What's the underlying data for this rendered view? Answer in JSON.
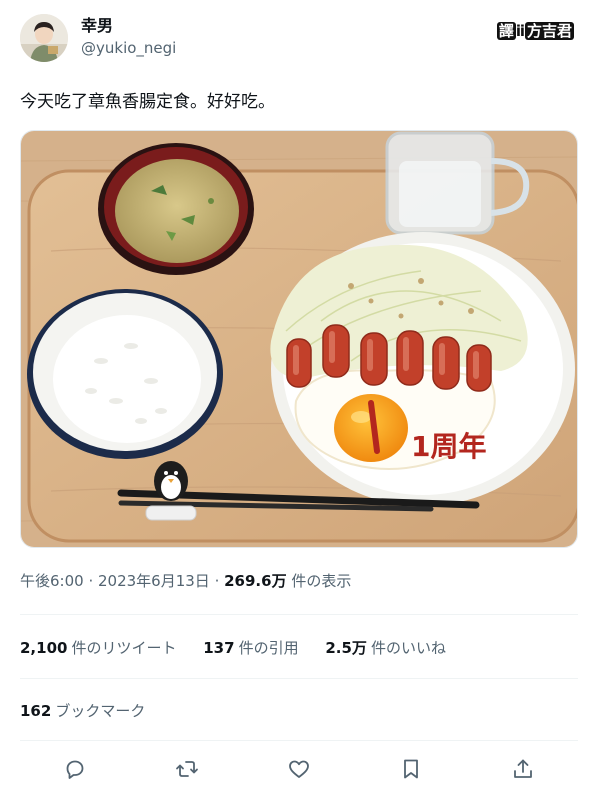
{
  "author": {
    "display_name": "幸男",
    "handle": "@yukio_negi"
  },
  "watermark": {
    "badge": "譯",
    "middle": "ⅱ",
    "name": "方吉君"
  },
  "tweet": {
    "text": "今天吃了章魚香腸定食。好好吃。",
    "photo_alt": "",
    "plate_writing": "1周年"
  },
  "meta": {
    "time": "午後6:00",
    "sep1": " · ",
    "date": "2023年6月13日",
    "sep2": " · ",
    "views_count": "269.6万",
    "views_label": " 件の表示"
  },
  "stats": {
    "retweets_count": "2,100",
    "retweets_label": "件のリツイート",
    "quotes_count": "137",
    "quotes_label": "件の引用",
    "likes_count": "2.5万",
    "likes_label": "件のいいね"
  },
  "bookmarks": {
    "count": "162",
    "label": "ブックマーク"
  },
  "actions": [
    "reply-icon",
    "retweet-icon",
    "like-icon",
    "bookmark-icon",
    "share-icon"
  ],
  "colors": {
    "text": "#0f1419",
    "secondary": "#536471",
    "divider": "#eff3f4"
  }
}
